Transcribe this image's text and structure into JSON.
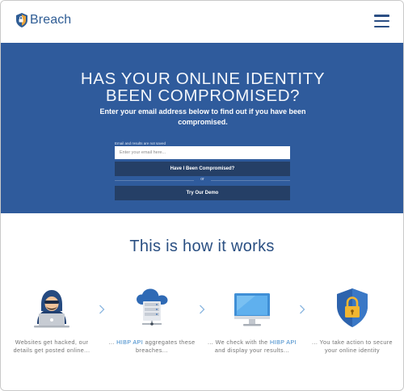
{
  "header": {
    "brand_name": "Breach",
    "logo_icon": "shield-logo-icon",
    "menu_icon": "hamburger-menu-icon"
  },
  "hero": {
    "title_line1": "HAS YOUR ONLINE IDENTITY",
    "title_line2": "BEEN COMPROMISED?",
    "subtitle": "Enter your email address below to find out if you have been compromised.",
    "note": "Email and results are not saved",
    "email_placeholder": "Enter your email here...",
    "check_button": "Have I Been Compromised?",
    "or_text": "or",
    "demo_button": "Try Our Demo"
  },
  "how": {
    "title": "This is how it works",
    "steps": [
      {
        "icon": "hacker-laptop-icon",
        "pre": "Websites get hacked, our details get posted online...",
        "link": "",
        "post": ""
      },
      {
        "icon": "cloud-server-icon",
        "pre": "... ",
        "link": "HIBP API",
        "post": " aggregates these breaches..."
      },
      {
        "icon": "monitor-icon",
        "pre": "... We check with the ",
        "link": "HIBP API",
        "post": " and display your results..."
      },
      {
        "icon": "shield-lock-icon",
        "pre": "... You take action to secure your online identity",
        "link": "",
        "post": ""
      }
    ]
  },
  "colors": {
    "brand": "#2f5d95",
    "hero_bg": "#2f5b9c",
    "button_bg": "#253f66",
    "link": "#3a86c9"
  }
}
